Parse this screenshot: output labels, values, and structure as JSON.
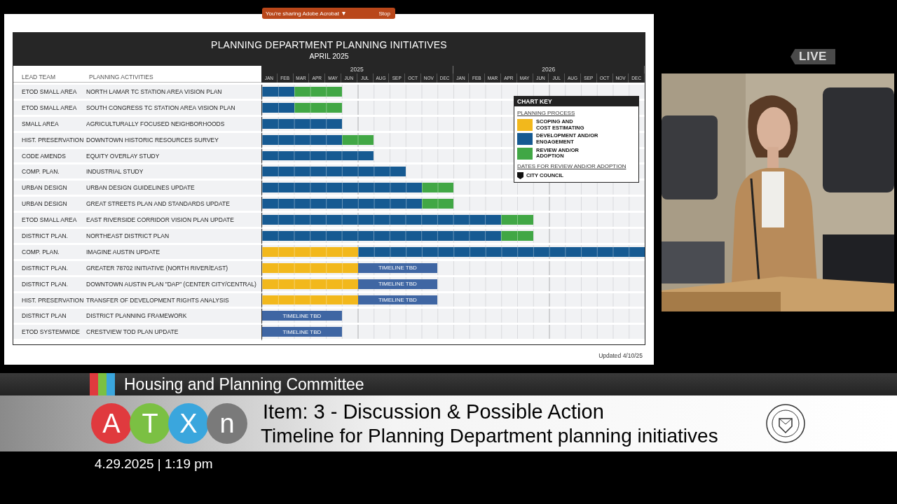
{
  "share_bar": {
    "text": "You're sharing Adobe Acrobat",
    "caret": "▾",
    "stop": "Stop"
  },
  "slide": {
    "title": "PLANNING DEPARTMENT PLANNING INITIATIVES",
    "subtitle": "APRIL 2025",
    "columns": [
      "LEAD TEAM",
      "PLANNING ACTIVITIES"
    ],
    "years": [
      "2025",
      "2026"
    ],
    "months": [
      "JAN",
      "FEB",
      "MAR",
      "APR",
      "MAY",
      "JUN",
      "JUL",
      "AUG",
      "SEP",
      "OCT",
      "NOV",
      "DEC",
      "JAN",
      "FEB",
      "MAR",
      "APR",
      "MAY",
      "JUN",
      "JUL",
      "AUG",
      "SEP",
      "OCT",
      "NOV",
      "DEC"
    ],
    "rows": [
      {
        "team": "ETOD SMALL AREA",
        "activity": "NORTH LAMAR TC STATION AREA VISION PLAN",
        "cells": [
          {
            "kind": "development"
          },
          {
            "kind": "development"
          },
          {
            "kind": "review"
          },
          {
            "kind": "review"
          },
          {
            "kind": "review"
          }
        ]
      },
      {
        "team": "ETOD SMALL AREA",
        "activity": "SOUTH CONGRESS TC STATION AREA VISION PLAN",
        "cells": [
          {
            "kind": "development"
          },
          {
            "kind": "development"
          },
          {
            "kind": "review"
          },
          {
            "kind": "review"
          },
          {
            "kind": "review"
          }
        ]
      },
      {
        "team": "SMALL AREA",
        "activity": "AGRICULTURALLY FOCUSED NEIGHBORHOODS",
        "cells": [
          {
            "kind": "development"
          },
          {
            "kind": "development"
          },
          {
            "kind": "development"
          },
          {
            "kind": "development"
          },
          {
            "kind": "development"
          }
        ]
      },
      {
        "team": "HIST. PRESERVATION",
        "activity": "DOWNTOWN HISTORIC RESOURCES SURVEY",
        "cells": [
          {
            "kind": "development"
          },
          {
            "kind": "development"
          },
          {
            "kind": "development"
          },
          {
            "kind": "development"
          },
          {
            "kind": "development"
          },
          {
            "kind": "review"
          },
          {
            "kind": "review"
          }
        ]
      },
      {
        "team": "CODE AMENDS",
        "activity": "EQUITY OVERLAY STUDY",
        "cells": [
          {
            "kind": "development"
          },
          {
            "kind": "development"
          },
          {
            "kind": "development"
          },
          {
            "kind": "development"
          },
          {
            "kind": "development"
          },
          {
            "kind": "development"
          },
          {
            "kind": "development"
          }
        ]
      },
      {
        "team": "COMP. PLAN.",
        "activity": "INDUSTRIAL STUDY",
        "cells": [
          {
            "kind": "development"
          },
          {
            "kind": "development"
          },
          {
            "kind": "development"
          },
          {
            "kind": "development"
          },
          {
            "kind": "development"
          },
          {
            "kind": "development"
          },
          {
            "kind": "development"
          },
          {
            "kind": "development"
          },
          {
            "kind": "development"
          }
        ]
      },
      {
        "team": "URBAN DESIGN",
        "activity": "URBAN DESIGN GUIDELINES UPDATE",
        "cells": [
          {
            "kind": "development"
          },
          {
            "kind": "development"
          },
          {
            "kind": "development"
          },
          {
            "kind": "development"
          },
          {
            "kind": "development"
          },
          {
            "kind": "development"
          },
          {
            "kind": "development"
          },
          {
            "kind": "development"
          },
          {
            "kind": "development"
          },
          {
            "kind": "development"
          },
          {
            "kind": "review"
          },
          {
            "kind": "review"
          }
        ]
      },
      {
        "team": "URBAN DESIGN",
        "activity": "GREAT STREETS PLAN AND STANDARDS UPDATE",
        "cells": [
          {
            "kind": "development"
          },
          {
            "kind": "development"
          },
          {
            "kind": "development"
          },
          {
            "kind": "development"
          },
          {
            "kind": "development"
          },
          {
            "kind": "development"
          },
          {
            "kind": "development"
          },
          {
            "kind": "development"
          },
          {
            "kind": "development"
          },
          {
            "kind": "development"
          },
          {
            "kind": "review"
          },
          {
            "kind": "review"
          }
        ]
      },
      {
        "team": "ETOD SMALL AREA",
        "activity": "EAST RIVERSIDE CORRIDOR VISION PLAN UPDATE",
        "cells": [
          {
            "kind": "development"
          },
          {
            "kind": "development"
          },
          {
            "kind": "development"
          },
          {
            "kind": "development"
          },
          {
            "kind": "development"
          },
          {
            "kind": "development"
          },
          {
            "kind": "development"
          },
          {
            "kind": "development"
          },
          {
            "kind": "development"
          },
          {
            "kind": "development"
          },
          {
            "kind": "development"
          },
          {
            "kind": "development"
          },
          {
            "kind": "development"
          },
          {
            "kind": "development"
          },
          {
            "kind": "development"
          },
          {
            "kind": "review"
          },
          {
            "kind": "review"
          }
        ]
      },
      {
        "team": "DISTRICT PLAN.",
        "activity": "NORTHEAST DISTRICT PLAN",
        "cells": [
          {
            "kind": "development"
          },
          {
            "kind": "development"
          },
          {
            "kind": "development"
          },
          {
            "kind": "development"
          },
          {
            "kind": "development"
          },
          {
            "kind": "development"
          },
          {
            "kind": "development"
          },
          {
            "kind": "development"
          },
          {
            "kind": "development"
          },
          {
            "kind": "development"
          },
          {
            "kind": "development"
          },
          {
            "kind": "development"
          },
          {
            "kind": "development"
          },
          {
            "kind": "development"
          },
          {
            "kind": "development"
          },
          {
            "kind": "review"
          },
          {
            "kind": "review"
          }
        ]
      },
      {
        "team": "COMP. PLAN.",
        "activity": "IMAGINE AUSTIN UPDATE",
        "cells": [
          {
            "kind": "scoping"
          },
          {
            "kind": "scoping"
          },
          {
            "kind": "scoping"
          },
          {
            "kind": "scoping"
          },
          {
            "kind": "scoping"
          },
          {
            "kind": "scoping"
          },
          {
            "kind": "development"
          },
          {
            "kind": "development"
          },
          {
            "kind": "development"
          },
          {
            "kind": "development"
          },
          {
            "kind": "development"
          },
          {
            "kind": "development"
          },
          {
            "kind": "development"
          },
          {
            "kind": "development"
          },
          {
            "kind": "development"
          },
          {
            "kind": "development"
          },
          {
            "kind": "development"
          },
          {
            "kind": "development"
          },
          {
            "kind": "development"
          },
          {
            "kind": "development"
          },
          {
            "kind": "development"
          },
          {
            "kind": "development"
          },
          {
            "kind": "development"
          },
          {
            "kind": "development"
          }
        ]
      },
      {
        "team": "DISTRICT PLAN.",
        "activity": "GREATER 78702 INITIATIVE (NORTH RIVER/EAST)",
        "cells": [
          {
            "kind": "scoping"
          },
          {
            "kind": "scoping"
          },
          {
            "kind": "scoping"
          },
          {
            "kind": "scoping"
          },
          {
            "kind": "scoping"
          },
          {
            "kind": "scoping"
          },
          {
            "kind": "tbd"
          },
          {
            "kind": "tbd"
          },
          {
            "kind": "tbd"
          },
          {
            "kind": "tbd"
          },
          {
            "kind": "tbd"
          }
        ],
        "bar_label": "TIMELINE TBD"
      },
      {
        "team": "DISTRICT PLAN.",
        "activity": "DOWNTOWN AUSTIN PLAN \"DAP\" (CENTER CITY/CENTRAL)",
        "cells": [
          {
            "kind": "scoping"
          },
          {
            "kind": "scoping"
          },
          {
            "kind": "scoping"
          },
          {
            "kind": "scoping"
          },
          {
            "kind": "scoping"
          },
          {
            "kind": "scoping"
          },
          {
            "kind": "tbd"
          },
          {
            "kind": "tbd"
          },
          {
            "kind": "tbd"
          },
          {
            "kind": "tbd"
          },
          {
            "kind": "tbd"
          }
        ],
        "bar_label": "TIMELINE TBD"
      },
      {
        "team": "HIST. PRESERVATION",
        "activity": "TRANSFER OF DEVELOPMENT RIGHTS ANALYSIS",
        "cells": [
          {
            "kind": "scoping"
          },
          {
            "kind": "scoping"
          },
          {
            "kind": "scoping"
          },
          {
            "kind": "scoping"
          },
          {
            "kind": "scoping"
          },
          {
            "kind": "scoping"
          },
          {
            "kind": "tbd"
          },
          {
            "kind": "tbd"
          },
          {
            "kind": "tbd"
          },
          {
            "kind": "tbd"
          },
          {
            "kind": "tbd"
          }
        ],
        "bar_label": "TIMELINE TBD"
      },
      {
        "team": "DISTRICT PLAN",
        "activity": "DISTRICT PLANNING FRAMEWORK",
        "cells": [
          {
            "kind": "tbd"
          },
          {
            "kind": "tbd"
          },
          {
            "kind": "tbd"
          },
          {
            "kind": "tbd"
          },
          {
            "kind": "tbd"
          }
        ],
        "bar_label": "TIMELINE TBD"
      },
      {
        "team": "ETOD SYSTEMWIDE",
        "activity": "CRESTVIEW TOD PLAN UPDATE",
        "cells": [
          {
            "kind": "tbd"
          },
          {
            "kind": "tbd"
          },
          {
            "kind": "tbd"
          },
          {
            "kind": "tbd"
          },
          {
            "kind": "tbd"
          }
        ],
        "bar_label": "TIMELINE TBD"
      }
    ],
    "key": {
      "title": "CHART KEY",
      "process_heading": "PLANNING PROCESS",
      "items": [
        {
          "kind": "scoping",
          "label": "SCOPING AND\nCOST ESTIMATING"
        },
        {
          "kind": "development",
          "label": "DEVELOPMENT AND/OR\nENGAGEMENT"
        },
        {
          "kind": "review",
          "label": "REVIEW AND/OR\nADOPTION"
        }
      ],
      "dates_heading": "DATES FOR REVIEW AND/OR ADOPTION",
      "council": "CITY COUNCIL"
    },
    "updated": "Updated 4/10/25"
  },
  "live": "LIVE",
  "lower_third": {
    "committee": "Housing and Planning Committee",
    "logo_letters": [
      "A",
      "T",
      "X",
      "n"
    ],
    "item": "Item: 3 - Discussion & Possible Action",
    "topic": "Timeline for Planning Department planning initiatives",
    "datetime": "4.29.2025 | 1:19 pm"
  }
}
